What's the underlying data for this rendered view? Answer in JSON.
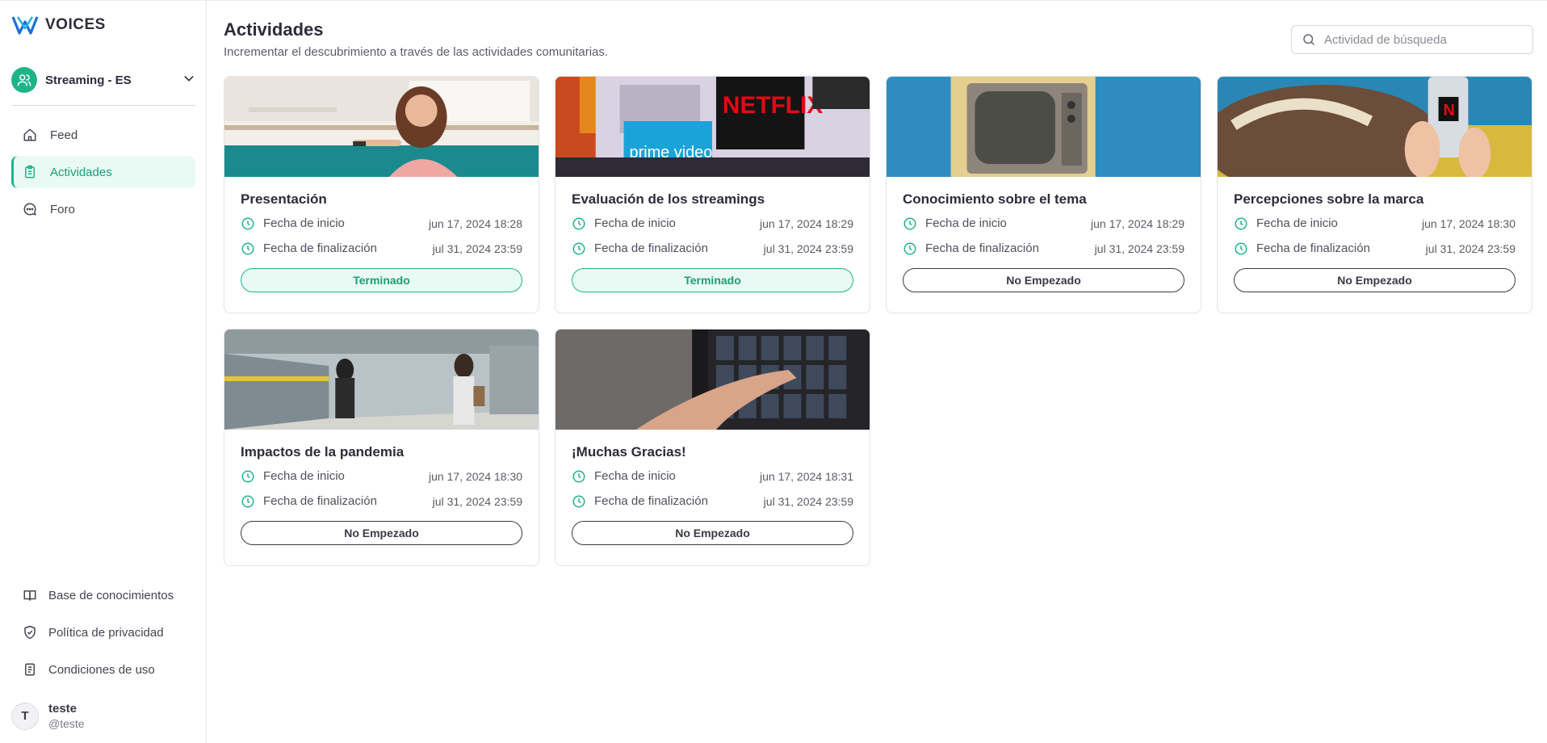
{
  "brand": {
    "name": "VOICES"
  },
  "community": {
    "name": "Streaming - ES"
  },
  "nav": [
    {
      "label": "Feed",
      "icon": "home-icon",
      "active": false
    },
    {
      "label": "Actividades",
      "icon": "clipboard-icon",
      "active": true
    },
    {
      "label": "Foro",
      "icon": "chat-icon",
      "active": false
    }
  ],
  "bottom_nav": [
    {
      "label": "Base de conocimientos",
      "icon": "book-icon"
    },
    {
      "label": "Política de privacidad",
      "icon": "shield-icon"
    },
    {
      "label": "Condiciones de uso",
      "icon": "document-icon"
    }
  ],
  "user": {
    "initial": "T",
    "name": "teste",
    "handle": "@teste"
  },
  "header": {
    "title": "Actividades",
    "subtitle": "Incrementar el descubrimiento a través de las actividades comunitarias."
  },
  "search": {
    "placeholder": "Actividad de búsqueda",
    "value": ""
  },
  "labels": {
    "start": "Fecha de inicio",
    "end": "Fecha de finalización"
  },
  "activities": [
    {
      "title": "Presentación",
      "start": "jun 17, 2024 18:28",
      "end": "jul 31, 2024 23:59",
      "status": "Terminado",
      "done": true
    },
    {
      "title": "Evaluación de los streamings",
      "start": "jun 17, 2024 18:29",
      "end": "jul 31, 2024 23:59",
      "status": "Terminado",
      "done": true
    },
    {
      "title": "Conocimiento sobre el tema",
      "start": "jun 17, 2024 18:29",
      "end": "jul 31, 2024 23:59",
      "status": "No Empezado",
      "done": false
    },
    {
      "title": "Percepciones sobre la marca",
      "start": "jun 17, 2024 18:30",
      "end": "jul 31, 2024 23:59",
      "status": "No Empezado",
      "done": false
    },
    {
      "title": "Impactos de la pandemia",
      "start": "jun 17, 2024 18:30",
      "end": "jul 31, 2024 23:59",
      "status": "No Empezado",
      "done": false
    },
    {
      "title": "¡Muchas Gracias!",
      "start": "jun 17, 2024 18:31",
      "end": "jul 31, 2024 23:59",
      "status": "No Empezado",
      "done": false
    }
  ],
  "images": [
    {
      "text1": "",
      "text2": ""
    },
    {
      "text1": "NETFLIX",
      "text2": "prime video"
    },
    {
      "text1": "",
      "text2": ""
    },
    {
      "text1": "N",
      "text2": ""
    },
    {
      "text1": "",
      "text2": ""
    },
    {
      "text1": "",
      "text2": ""
    }
  ],
  "colors": {
    "accent": "#1fb38a",
    "accent_light": "#e8faf3",
    "text": "#2c2c3a"
  }
}
